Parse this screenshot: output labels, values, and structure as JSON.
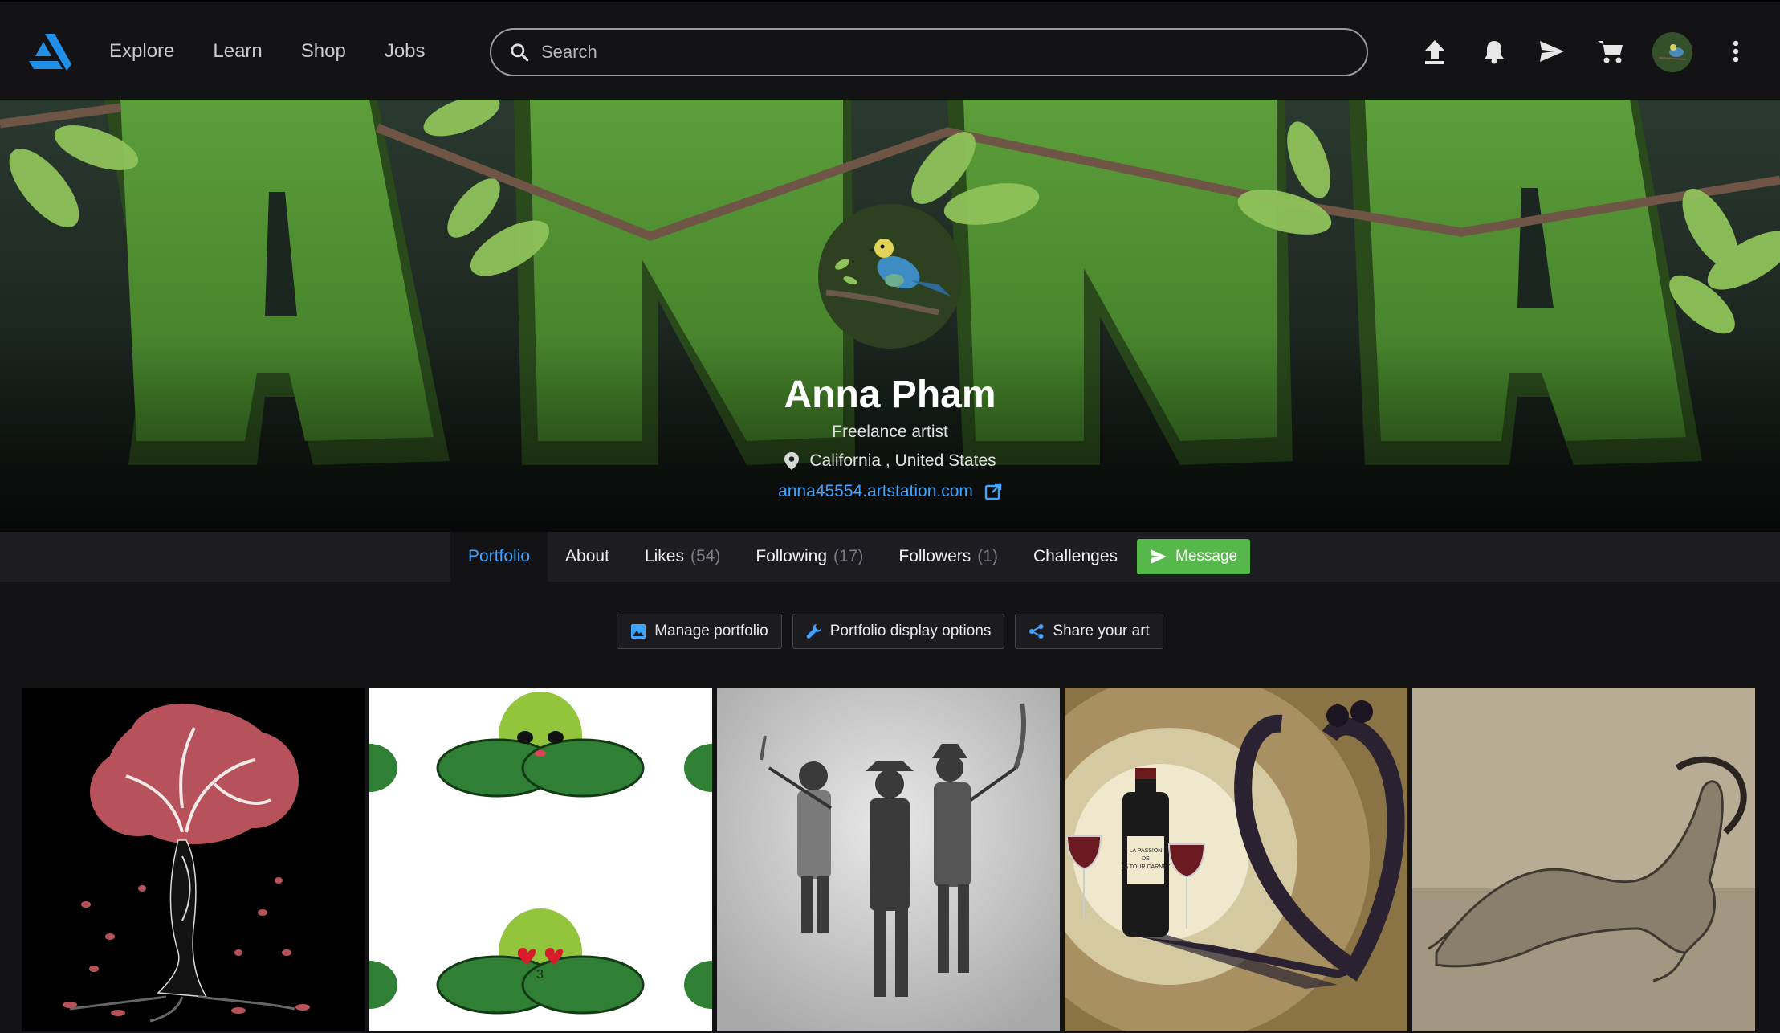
{
  "nav": {
    "explore": "Explore",
    "learn": "Learn",
    "shop": "Shop",
    "jobs": "Jobs"
  },
  "search": {
    "placeholder": "Search"
  },
  "banner": {
    "letters": "ANNA"
  },
  "profile": {
    "name": "Anna Pham",
    "headline": "Freelance artist",
    "location": "California , United States",
    "website": "anna45554.artstation.com"
  },
  "tabs": {
    "portfolio": "Portfolio",
    "about": "About",
    "likes": "Likes",
    "likes_count": "(54)",
    "following": "Following",
    "following_count": "(17)",
    "followers": "Followers",
    "followers_count": "(1)",
    "challenges": "Challenges",
    "message": "Message"
  },
  "actions": {
    "manage": "Manage portfolio",
    "display": "Portfolio display options",
    "share": "Share your art"
  },
  "bottle_label": [
    "LA PASSION",
    "DE",
    "LA TOUR CARNET"
  ],
  "colors": {
    "accent": "#3fa4ff",
    "message": "#56b84a",
    "background": "#131316"
  }
}
